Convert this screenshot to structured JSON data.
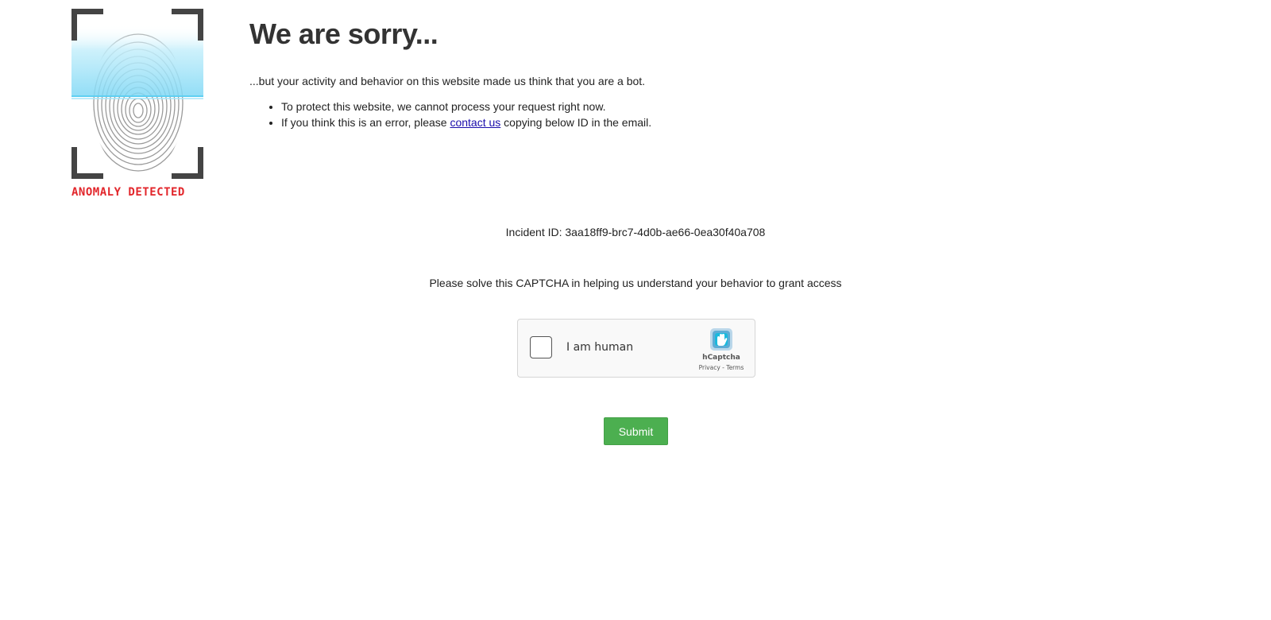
{
  "logo": {
    "caption": "ANOMALY DETECTED",
    "icon": "fingerprint-scan-icon",
    "scan_color": "#7fd8f5",
    "frame_color": "#444444",
    "caption_color": "#e2262b"
  },
  "header": {
    "title": "We are sorry...",
    "intro": "...but your activity and behavior on this website made us think that you are a bot.",
    "bullets": {
      "first": "To protect this website, we cannot process your request right now.",
      "second_before": "If you think this is an error, please ",
      "second_link": "contact us",
      "second_after": " copying below ID in the email."
    }
  },
  "incident": {
    "text": "Incident ID: 3aa18ff9-brc7-4d0b-ae66-0ea30f40a708"
  },
  "captcha": {
    "prompt": "Please solve this CAPTCHA in helping us understand your behavior to grant access",
    "label": "I am human",
    "brand": "hCaptcha",
    "privacy": "Privacy",
    "separator": " - ",
    "terms": "Terms",
    "icon": "hcaptcha-logo-icon"
  },
  "form": {
    "submit_label": "Submit",
    "submit_color": "#4caf50"
  }
}
